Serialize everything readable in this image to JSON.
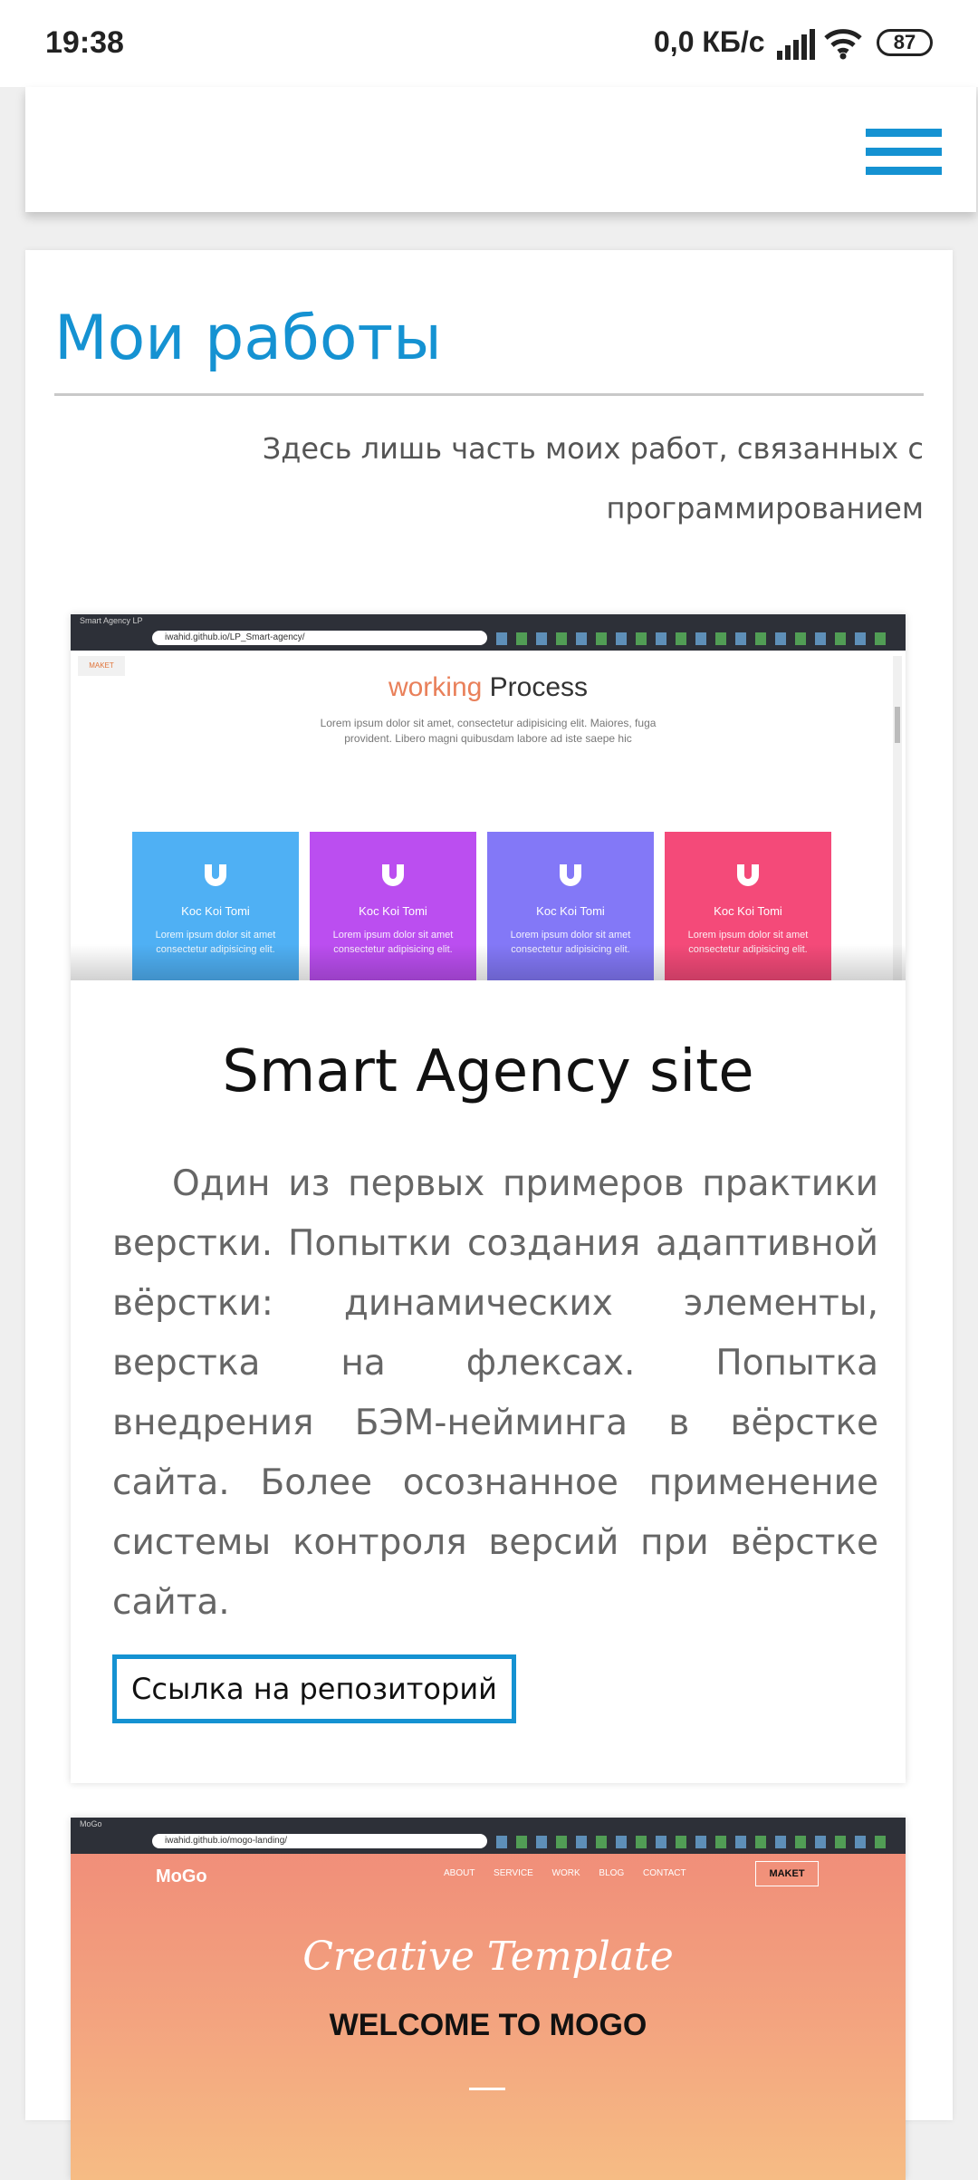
{
  "status_bar": {
    "time": "19:38",
    "network_speed": "0,0 КБ/с",
    "battery": "87"
  },
  "header": {
    "menu_icon": "hamburger-menu-icon",
    "accent_color": "#1592d2"
  },
  "main": {
    "title": "Мои работы",
    "subtitle": "Здесь лишь часть моих работ, связанных с программированием"
  },
  "projects": [
    {
      "title": "Smart Agency site",
      "description": "Один из первых примеров практики верстки. Попытки создания адаптивной вёрстки: динамических элементы, верстка на флексах. Попытка внедрения БЭМ-нейминга в вёрстке сайта. Более осознанное применение системы контроля версий при вёрстке сайта.",
      "link_label": "Ссылка на репозиторий",
      "screenshot": {
        "tab_title": "Smart Agency LP",
        "url": "iwahid.github.io/LP_Smart-agency/",
        "badge": "MAKET",
        "heading_accent": "working",
        "heading_rest": "Process",
        "lead": "Lorem ipsum dolor sit amet, consectetur adipisicing elit. Maiores, fuga provident. Libero magni quibusdam labore ad iste saepe hic",
        "tiles": [
          {
            "name": "Koc Koi Tomi",
            "text": "Lorem ipsum dolor sit amet consectetur adipisicing elit.",
            "color": "#4fb0f4"
          },
          {
            "name": "Koc Koi Tomi",
            "text": "Lorem ipsum dolor sit amet consectetur adipisicing elit.",
            "color": "#bb4ef0"
          },
          {
            "name": "Koc Koi Tomi",
            "text": "Lorem ipsum dolor sit amet consectetur adipisicing elit.",
            "color": "#8378f7"
          },
          {
            "name": "Koc Koi Tomi",
            "text": "Lorem ipsum dolor sit amet consectetur adipisicing elit.",
            "color": "#f44a79"
          }
        ]
      }
    },
    {
      "screenshot": {
        "tab_title": "MoGo",
        "url": "iwahid.github.io/mogo-landing/",
        "logo": "MoGo",
        "nav": "ABOUT SERVICE WORK BLOG CONTACT",
        "badge": "MAKET",
        "script_title": "Creative Template",
        "welcome": "WELCOME TO MOGO"
      }
    }
  ]
}
